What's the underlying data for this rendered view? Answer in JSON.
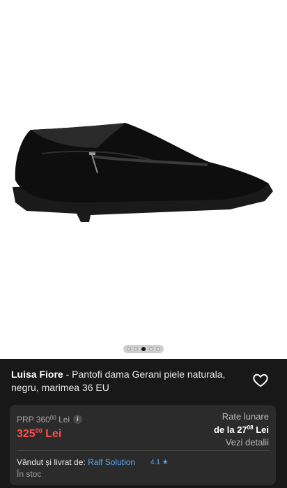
{
  "product": {
    "brand": "Luisa Fiore",
    "title": "- Pantofi dama Gerani piele naturala, negru, marimea 36 EU"
  },
  "gallery": {
    "image_icon": "black-leather-shoe-with-zipper",
    "dots_count": 5,
    "active_dot": 2
  },
  "pricing": {
    "prp_label": "PRP 360",
    "prp_cents": "00",
    "prp_currency": "Lei",
    "price_main": "325",
    "price_cents": "00",
    "price_currency": "Lei",
    "price_color": "#ff4d4d",
    "info_icon": "i"
  },
  "installments": {
    "label": "Rate lunare",
    "from_prefix": "de la 27",
    "from_cents": "08",
    "from_currency": "Lei",
    "details_link": "Vezi detalii"
  },
  "seller": {
    "label": "Vândut și livrat de:",
    "name": "Ralf Solution",
    "rating": "4.1",
    "rating_icon": "★",
    "stock": "În stoc",
    "link_color": "#5aa8f0"
  }
}
